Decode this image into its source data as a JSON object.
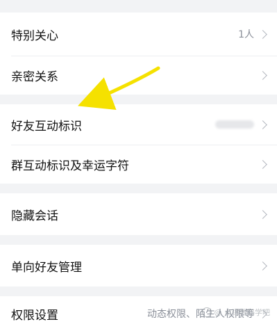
{
  "settings": {
    "special_care": {
      "label": "特别关心",
      "value": "1人"
    },
    "intimate": {
      "label": "亲密关系"
    },
    "friend_interaction": {
      "label": "好友互动标识",
      "value": "blurred"
    },
    "group_interaction": {
      "label": "群互动标识及幸运字符"
    },
    "hidden_chats": {
      "label": "隐藏会话"
    },
    "one_way_friends": {
      "label": "单向好友管理"
    },
    "permissions": {
      "label": "权限设置",
      "value": "动态权限、陌生人权限等"
    }
  },
  "annotation": {
    "arrow_color": "#f5e100"
  },
  "watermark": {
    "text": "@ 点评数码学吧"
  }
}
